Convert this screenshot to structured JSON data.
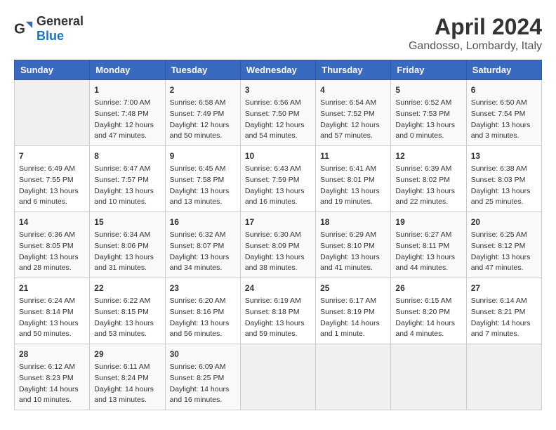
{
  "header": {
    "logo": {
      "general": "General",
      "blue": "Blue"
    },
    "month": "April 2024",
    "location": "Gandosso, Lombardy, Italy"
  },
  "weekdays": [
    "Sunday",
    "Monday",
    "Tuesday",
    "Wednesday",
    "Thursday",
    "Friday",
    "Saturday"
  ],
  "weeks": [
    [
      {
        "day": "",
        "empty": true
      },
      {
        "day": "1",
        "sunrise": "Sunrise: 7:00 AM",
        "sunset": "Sunset: 7:48 PM",
        "daylight": "Daylight: 12 hours and 47 minutes."
      },
      {
        "day": "2",
        "sunrise": "Sunrise: 6:58 AM",
        "sunset": "Sunset: 7:49 PM",
        "daylight": "Daylight: 12 hours and 50 minutes."
      },
      {
        "day": "3",
        "sunrise": "Sunrise: 6:56 AM",
        "sunset": "Sunset: 7:50 PM",
        "daylight": "Daylight: 12 hours and 54 minutes."
      },
      {
        "day": "4",
        "sunrise": "Sunrise: 6:54 AM",
        "sunset": "Sunset: 7:52 PM",
        "daylight": "Daylight: 12 hours and 57 minutes."
      },
      {
        "day": "5",
        "sunrise": "Sunrise: 6:52 AM",
        "sunset": "Sunset: 7:53 PM",
        "daylight": "Daylight: 13 hours and 0 minutes."
      },
      {
        "day": "6",
        "sunrise": "Sunrise: 6:50 AM",
        "sunset": "Sunset: 7:54 PM",
        "daylight": "Daylight: 13 hours and 3 minutes."
      }
    ],
    [
      {
        "day": "7",
        "sunrise": "Sunrise: 6:49 AM",
        "sunset": "Sunset: 7:55 PM",
        "daylight": "Daylight: 13 hours and 6 minutes."
      },
      {
        "day": "8",
        "sunrise": "Sunrise: 6:47 AM",
        "sunset": "Sunset: 7:57 PM",
        "daylight": "Daylight: 13 hours and 10 minutes."
      },
      {
        "day": "9",
        "sunrise": "Sunrise: 6:45 AM",
        "sunset": "Sunset: 7:58 PM",
        "daylight": "Daylight: 13 hours and 13 minutes."
      },
      {
        "day": "10",
        "sunrise": "Sunrise: 6:43 AM",
        "sunset": "Sunset: 7:59 PM",
        "daylight": "Daylight: 13 hours and 16 minutes."
      },
      {
        "day": "11",
        "sunrise": "Sunrise: 6:41 AM",
        "sunset": "Sunset: 8:01 PM",
        "daylight": "Daylight: 13 hours and 19 minutes."
      },
      {
        "day": "12",
        "sunrise": "Sunrise: 6:39 AM",
        "sunset": "Sunset: 8:02 PM",
        "daylight": "Daylight: 13 hours and 22 minutes."
      },
      {
        "day": "13",
        "sunrise": "Sunrise: 6:38 AM",
        "sunset": "Sunset: 8:03 PM",
        "daylight": "Daylight: 13 hours and 25 minutes."
      }
    ],
    [
      {
        "day": "14",
        "sunrise": "Sunrise: 6:36 AM",
        "sunset": "Sunset: 8:05 PM",
        "daylight": "Daylight: 13 hours and 28 minutes."
      },
      {
        "day": "15",
        "sunrise": "Sunrise: 6:34 AM",
        "sunset": "Sunset: 8:06 PM",
        "daylight": "Daylight: 13 hours and 31 minutes."
      },
      {
        "day": "16",
        "sunrise": "Sunrise: 6:32 AM",
        "sunset": "Sunset: 8:07 PM",
        "daylight": "Daylight: 13 hours and 34 minutes."
      },
      {
        "day": "17",
        "sunrise": "Sunrise: 6:30 AM",
        "sunset": "Sunset: 8:09 PM",
        "daylight": "Daylight: 13 hours and 38 minutes."
      },
      {
        "day": "18",
        "sunrise": "Sunrise: 6:29 AM",
        "sunset": "Sunset: 8:10 PM",
        "daylight": "Daylight: 13 hours and 41 minutes."
      },
      {
        "day": "19",
        "sunrise": "Sunrise: 6:27 AM",
        "sunset": "Sunset: 8:11 PM",
        "daylight": "Daylight: 13 hours and 44 minutes."
      },
      {
        "day": "20",
        "sunrise": "Sunrise: 6:25 AM",
        "sunset": "Sunset: 8:12 PM",
        "daylight": "Daylight: 13 hours and 47 minutes."
      }
    ],
    [
      {
        "day": "21",
        "sunrise": "Sunrise: 6:24 AM",
        "sunset": "Sunset: 8:14 PM",
        "daylight": "Daylight: 13 hours and 50 minutes."
      },
      {
        "day": "22",
        "sunrise": "Sunrise: 6:22 AM",
        "sunset": "Sunset: 8:15 PM",
        "daylight": "Daylight: 13 hours and 53 minutes."
      },
      {
        "day": "23",
        "sunrise": "Sunrise: 6:20 AM",
        "sunset": "Sunset: 8:16 PM",
        "daylight": "Daylight: 13 hours and 56 minutes."
      },
      {
        "day": "24",
        "sunrise": "Sunrise: 6:19 AM",
        "sunset": "Sunset: 8:18 PM",
        "daylight": "Daylight: 13 hours and 59 minutes."
      },
      {
        "day": "25",
        "sunrise": "Sunrise: 6:17 AM",
        "sunset": "Sunset: 8:19 PM",
        "daylight": "Daylight: 14 hours and 1 minute."
      },
      {
        "day": "26",
        "sunrise": "Sunrise: 6:15 AM",
        "sunset": "Sunset: 8:20 PM",
        "daylight": "Daylight: 14 hours and 4 minutes."
      },
      {
        "day": "27",
        "sunrise": "Sunrise: 6:14 AM",
        "sunset": "Sunset: 8:21 PM",
        "daylight": "Daylight: 14 hours and 7 minutes."
      }
    ],
    [
      {
        "day": "28",
        "sunrise": "Sunrise: 6:12 AM",
        "sunset": "Sunset: 8:23 PM",
        "daylight": "Daylight: 14 hours and 10 minutes."
      },
      {
        "day": "29",
        "sunrise": "Sunrise: 6:11 AM",
        "sunset": "Sunset: 8:24 PM",
        "daylight": "Daylight: 14 hours and 13 minutes."
      },
      {
        "day": "30",
        "sunrise": "Sunrise: 6:09 AM",
        "sunset": "Sunset: 8:25 PM",
        "daylight": "Daylight: 14 hours and 16 minutes."
      },
      {
        "day": "",
        "empty": true
      },
      {
        "day": "",
        "empty": true
      },
      {
        "day": "",
        "empty": true
      },
      {
        "day": "",
        "empty": true
      }
    ]
  ]
}
